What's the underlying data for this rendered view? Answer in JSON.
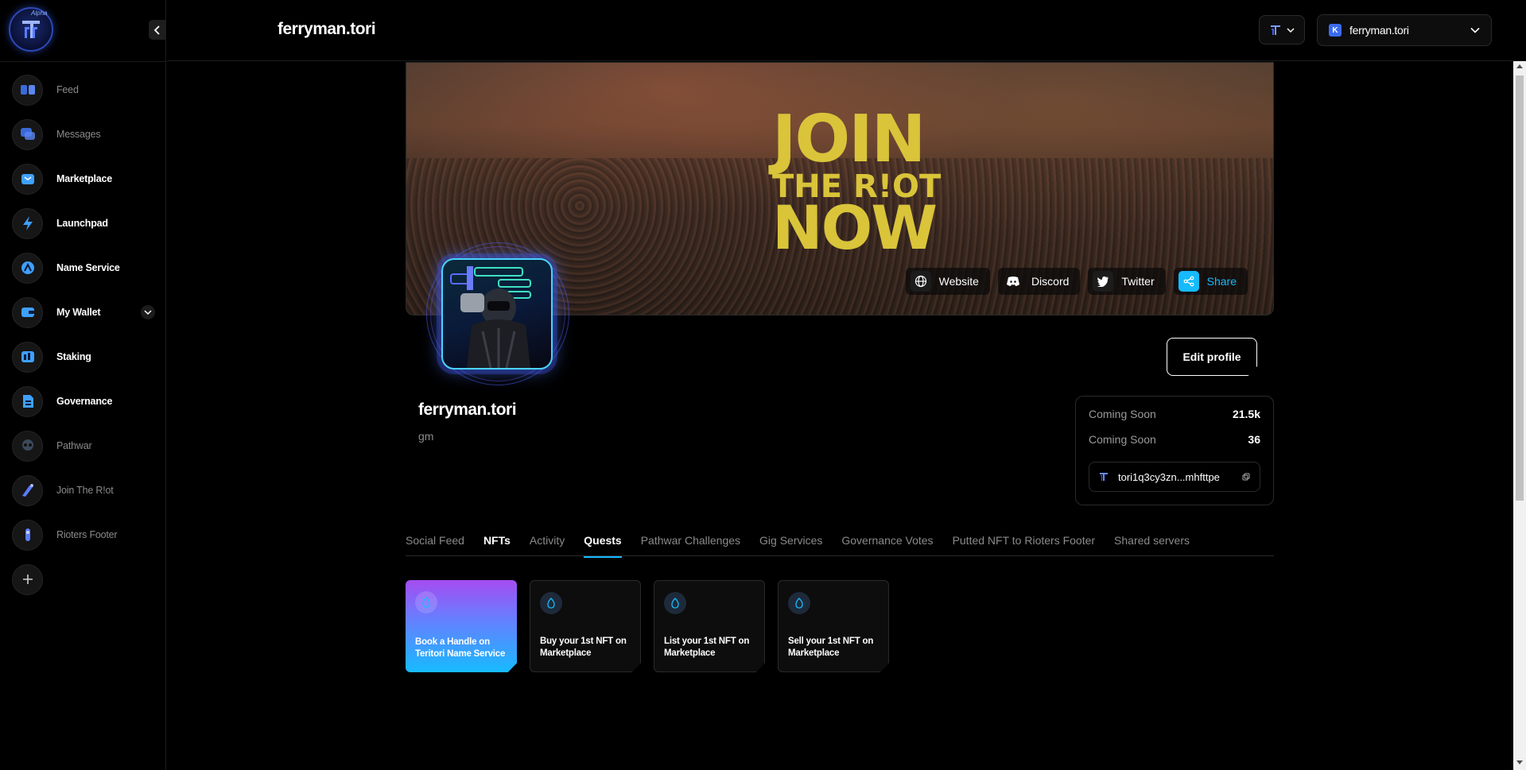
{
  "app": {
    "title": "ferryman.tori",
    "logo_badge": "Alpha"
  },
  "sidebar": {
    "items": [
      {
        "label": "Feed",
        "icon": "feed-icon",
        "dim": true
      },
      {
        "label": "Messages",
        "icon": "messages-icon",
        "dim": true
      },
      {
        "label": "Marketplace",
        "icon": "marketplace-icon",
        "dim": false
      },
      {
        "label": "Launchpad",
        "icon": "launchpad-icon",
        "dim": false
      },
      {
        "label": "Name Service",
        "icon": "name-service-icon",
        "dim": false
      },
      {
        "label": "My Wallet",
        "icon": "wallet-icon",
        "dim": false
      },
      {
        "label": "Staking",
        "icon": "staking-icon",
        "dim": false
      },
      {
        "label": "Governance",
        "icon": "governance-icon",
        "dim": false
      },
      {
        "label": "Pathwar",
        "icon": "pathwar-icon",
        "dim": true
      },
      {
        "label": "Join The R!ot",
        "icon": "riot-icon",
        "dim": true
      },
      {
        "label": "Rioters Footer",
        "icon": "rioters-footer-icon",
        "dim": true
      }
    ],
    "add_label": "+"
  },
  "header": {
    "wallet_badge": "K",
    "wallet_name": "ferryman.tori"
  },
  "banner": {
    "line1": "JOIN",
    "line2": "THE R!OT",
    "line3": "NOW",
    "links": [
      {
        "label": "Website",
        "icon": "globe-icon"
      },
      {
        "label": "Discord",
        "icon": "discord-icon"
      },
      {
        "label": "Twitter",
        "icon": "twitter-icon"
      },
      {
        "label": "Share",
        "icon": "share-icon"
      }
    ]
  },
  "profile": {
    "name": "ferryman.tori",
    "bio": "gm",
    "edit_label": "Edit profile",
    "stats": [
      {
        "label": "Coming Soon",
        "value": "21.5k"
      },
      {
        "label": "Coming Soon",
        "value": "36"
      }
    ],
    "address": "tori1q3cy3zn...mhfttpe"
  },
  "tabs": [
    {
      "label": "Social Feed",
      "state": "normal"
    },
    {
      "label": "NFTs",
      "state": "white"
    },
    {
      "label": "Activity",
      "state": "normal"
    },
    {
      "label": "Quests",
      "state": "selected"
    },
    {
      "label": "Pathwar Challenges",
      "state": "normal"
    },
    {
      "label": "Gig Services",
      "state": "normal"
    },
    {
      "label": "Governance Votes",
      "state": "normal"
    },
    {
      "label": "Putted NFT to Rioters Footer",
      "state": "normal"
    },
    {
      "label": "Shared servers",
      "state": "normal"
    }
  ],
  "quests": [
    {
      "label": "Book a Handle on Teritori Name Service",
      "active": true
    },
    {
      "label": "Buy your 1st NFT on Marketplace",
      "active": false
    },
    {
      "label": "List your 1st NFT on Marketplace",
      "active": false
    },
    {
      "label": "Sell your 1st NFT on Marketplace",
      "active": false
    }
  ],
  "colors": {
    "accent": "#16bbff",
    "banner_text": "#d9c43a",
    "quest_gradient_top": "#a54cf0"
  }
}
